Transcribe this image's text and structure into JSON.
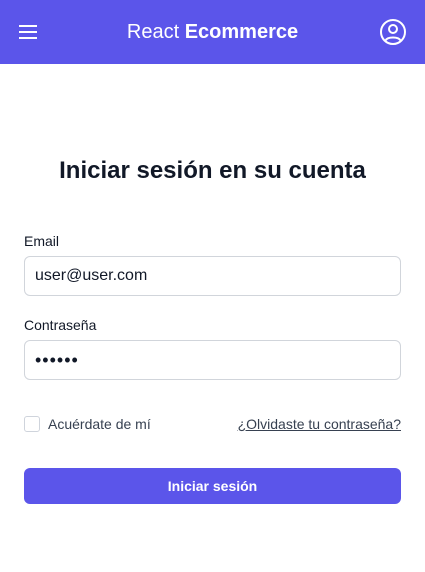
{
  "header": {
    "brand_light": "React",
    "brand_bold": "Ecommerce",
    "menu_icon": "hamburger-menu-icon",
    "user_icon": "user-circle-icon"
  },
  "login": {
    "title": "Iniciar sesión en su cuenta",
    "email_label": "Email",
    "email_value": "user@user.com",
    "password_label": "Contraseña",
    "password_value": "••••••",
    "remember_label": "Acuérdate de mí",
    "remember_checked": false,
    "forgot_link": "¿Olvidaste tu contraseña?",
    "submit_label": "Iniciar sesión"
  },
  "colors": {
    "accent": "#5b55ea",
    "text": "#111827",
    "border": "#d1d5db"
  }
}
